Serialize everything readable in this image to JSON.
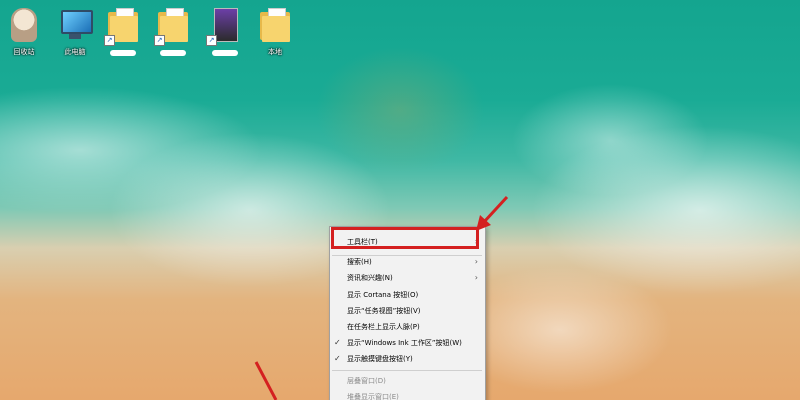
{
  "desktop": {
    "icons": [
      {
        "label": "回收站",
        "icon": "recycle-bin-icon"
      },
      {
        "label": "此电脑",
        "icon": "computer-icon"
      },
      {
        "label": "",
        "icon": "folder-icon"
      },
      {
        "label": "",
        "icon": "folder-icon"
      },
      {
        "label": "",
        "icon": "app-icon"
      },
      {
        "label": "本地",
        "icon": "folder-icon"
      }
    ]
  },
  "context_menu": {
    "items": [
      {
        "label": "工具栏(T)",
        "submenu": true,
        "checked": false,
        "disabled": false
      },
      {
        "label": "搜索(H)",
        "submenu": true,
        "checked": false,
        "disabled": false
      },
      {
        "label": "资讯和兴趣(N)",
        "submenu": true,
        "checked": false,
        "disabled": false
      },
      {
        "label": "显示 Cortana 按钮(O)",
        "submenu": false,
        "checked": false,
        "disabled": false
      },
      {
        "label": "显示“任务视图”按钮(V)",
        "submenu": false,
        "checked": false,
        "disabled": false
      },
      {
        "label": "在任务栏上显示人脉(P)",
        "submenu": false,
        "checked": false,
        "disabled": false
      },
      {
        "label": "显示“Windows Ink 工作区”按钮(W)",
        "submenu": false,
        "checked": true,
        "disabled": false
      },
      {
        "label": "显示触摸键盘按钮(Y)",
        "submenu": false,
        "checked": true,
        "disabled": false
      },
      {
        "label": "层叠窗口(D)",
        "submenu": false,
        "checked": false,
        "disabled": true
      },
      {
        "label": "堆叠显示窗口(E)",
        "submenu": false,
        "checked": false,
        "disabled": true
      }
    ],
    "check_glyph": "✓",
    "submenu_glyph": "›"
  },
  "annotations": {
    "highlight_color": "#d42020"
  }
}
